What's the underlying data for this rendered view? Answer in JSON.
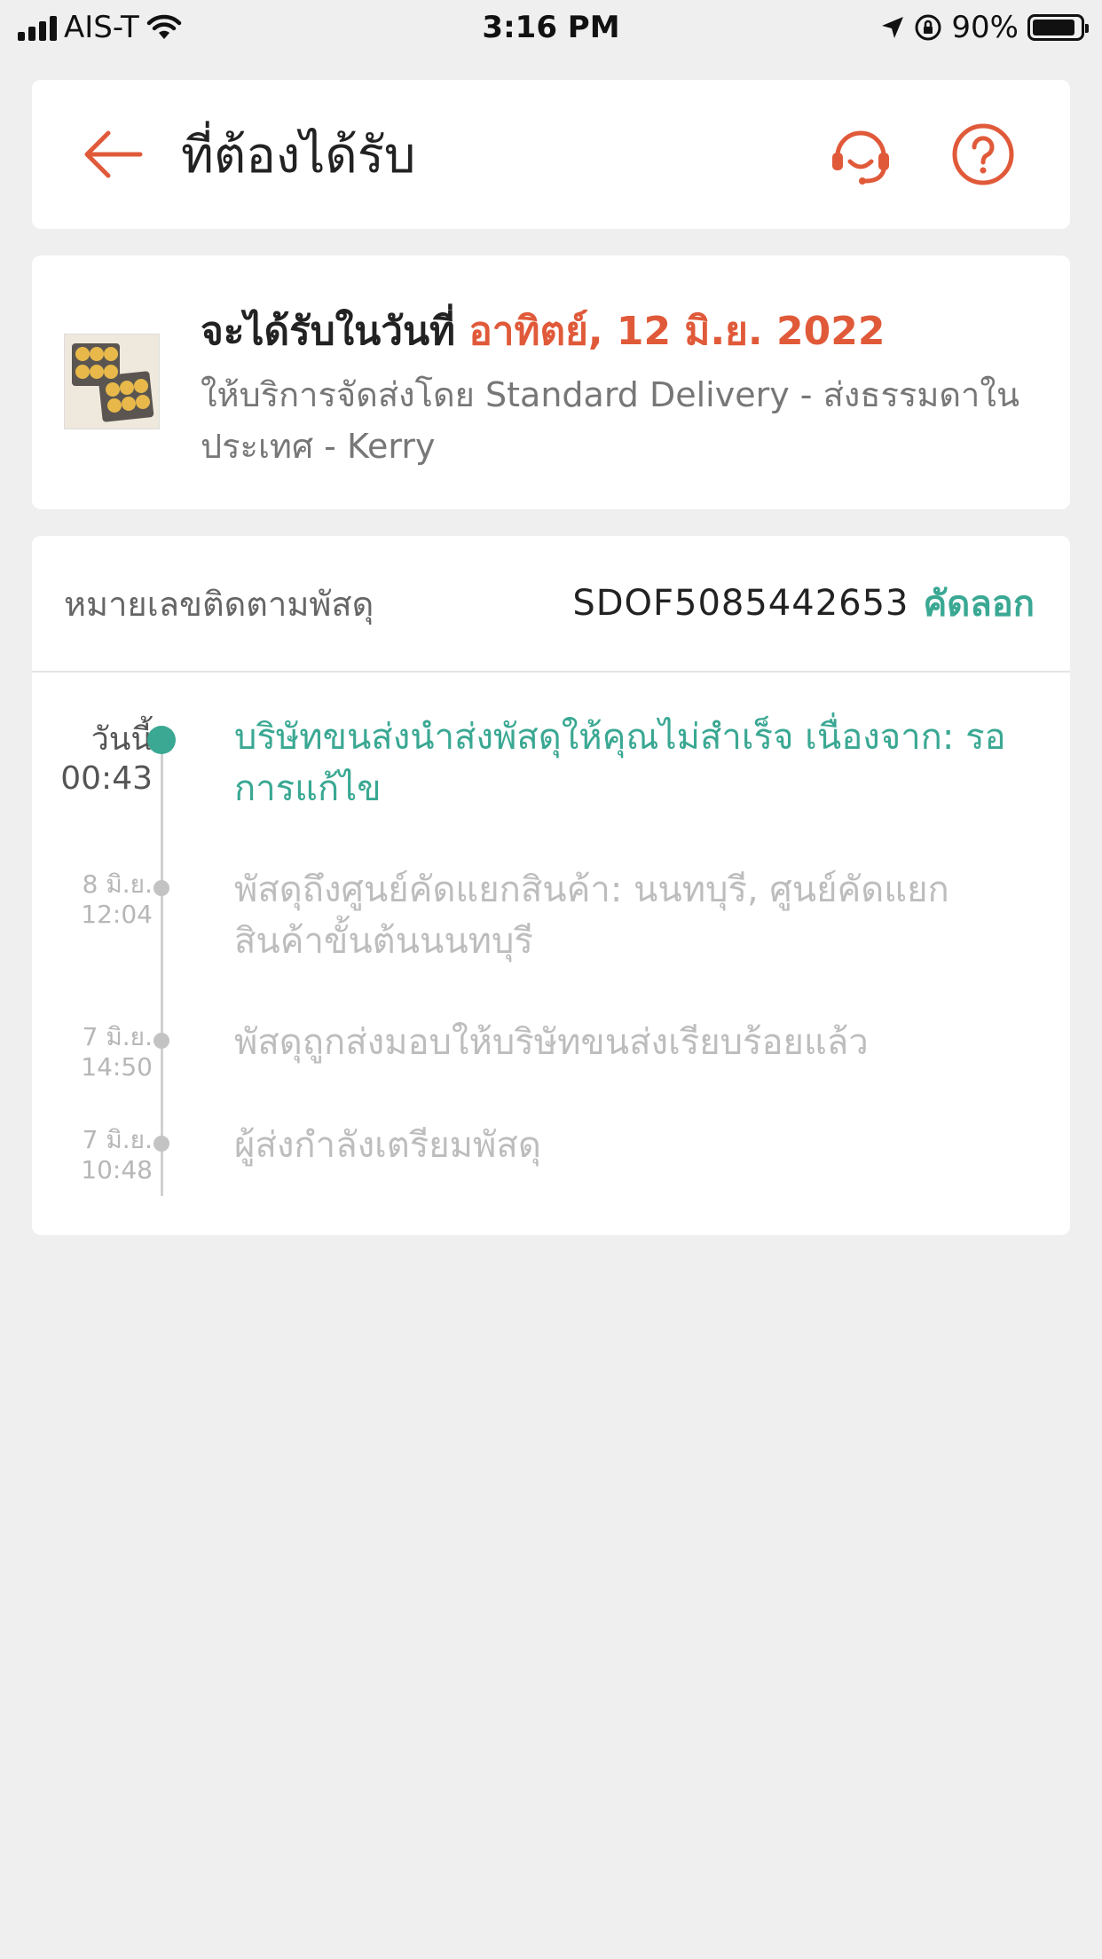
{
  "status_bar": {
    "carrier": "AIS-T",
    "time": "3:16 PM",
    "battery": "90%",
    "battery_level": 0.9
  },
  "header": {
    "title": "ที่ต้องได้รับ",
    "back_icon": "arrow-left-icon",
    "support_icon": "headset-icon",
    "help_icon": "question-circle-icon",
    "accent_color": "#e05a3a"
  },
  "delivery": {
    "title_prefix": "จะได้รับในวันที่",
    "date": "อาทิตย์, 12 มิ.ย. 2022",
    "description": "ให้บริการจัดส่งโดย Standard Delivery - ส่งธรรมดาในประเทศ - Kerry"
  },
  "tracking": {
    "label": "หมายเลขติดตามพัสดุ",
    "number": "SDOF5085442653",
    "copy_label": "คัดลอก",
    "accent_color": "#3aa893",
    "events": [
      {
        "date": "วันนี้",
        "time": "00:43",
        "text": "บริษัทขนส่งนำส่งพัสดุให้คุณไม่สำเร็จ เนื่องจาก: รอการแก้ไข",
        "active": true
      },
      {
        "date": "8 มิ.ย.",
        "time": "12:04",
        "text": "พัสดุถึงศูนย์คัดแยกสินค้า: นนทบุรี, ศูนย์คัดแยกสินค้าขั้นต้นนนทบุรี",
        "active": false
      },
      {
        "date": "7 มิ.ย.",
        "time": "14:50",
        "text": "พัสดุถูกส่งมอบให้บริษัทขนส่งเรียบร้อยแล้ว",
        "active": false
      },
      {
        "date": "7 มิ.ย.",
        "time": "10:48",
        "text": "ผู้ส่งกำลังเตรียมพัสดุ",
        "active": false
      }
    ]
  }
}
